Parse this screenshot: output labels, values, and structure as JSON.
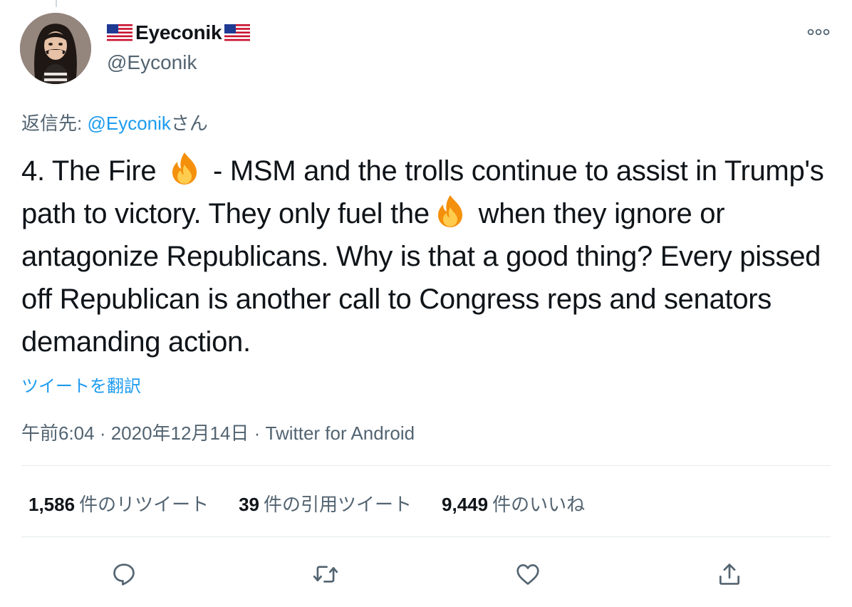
{
  "author": {
    "name": "Eyeconik",
    "handle": "@Eyconik",
    "flag_icon": "us-flag-icon"
  },
  "reply_to": {
    "prefix": "返信先: ",
    "mention": "@Eyconik",
    "suffix": "さん"
  },
  "tweet": {
    "part1": "4. The Fire ",
    "part2": " - MSM and the trolls continue to assist in Trump's path to victory. They only fuel the",
    "part3": " when they ignore or antagonize Republicans. Why is that a good thing? Every pissed off Republican is another call to Congress reps and senators demanding action.",
    "emoji": "fire-emoji"
  },
  "translate_label": "ツイートを翻訳",
  "meta": {
    "time": "午前6:04",
    "separator": " · ",
    "date": "2020年12月14日",
    "source": "Twitter for Android"
  },
  "stats": {
    "retweets_count": "1,586",
    "retweets_label": "件のリツイート",
    "quotes_count": "39",
    "quotes_label": "件の引用ツイート",
    "likes_count": "9,449",
    "likes_label": "件のいいね"
  },
  "icons": {
    "more": "more-options-icon",
    "reply": "reply-icon",
    "retweet": "retweet-icon",
    "like": "like-icon",
    "share": "share-icon"
  },
  "colors": {
    "accent": "#1d9bf0",
    "text": "#0f1419",
    "secondary": "#536471",
    "divider": "#e6ebee"
  }
}
